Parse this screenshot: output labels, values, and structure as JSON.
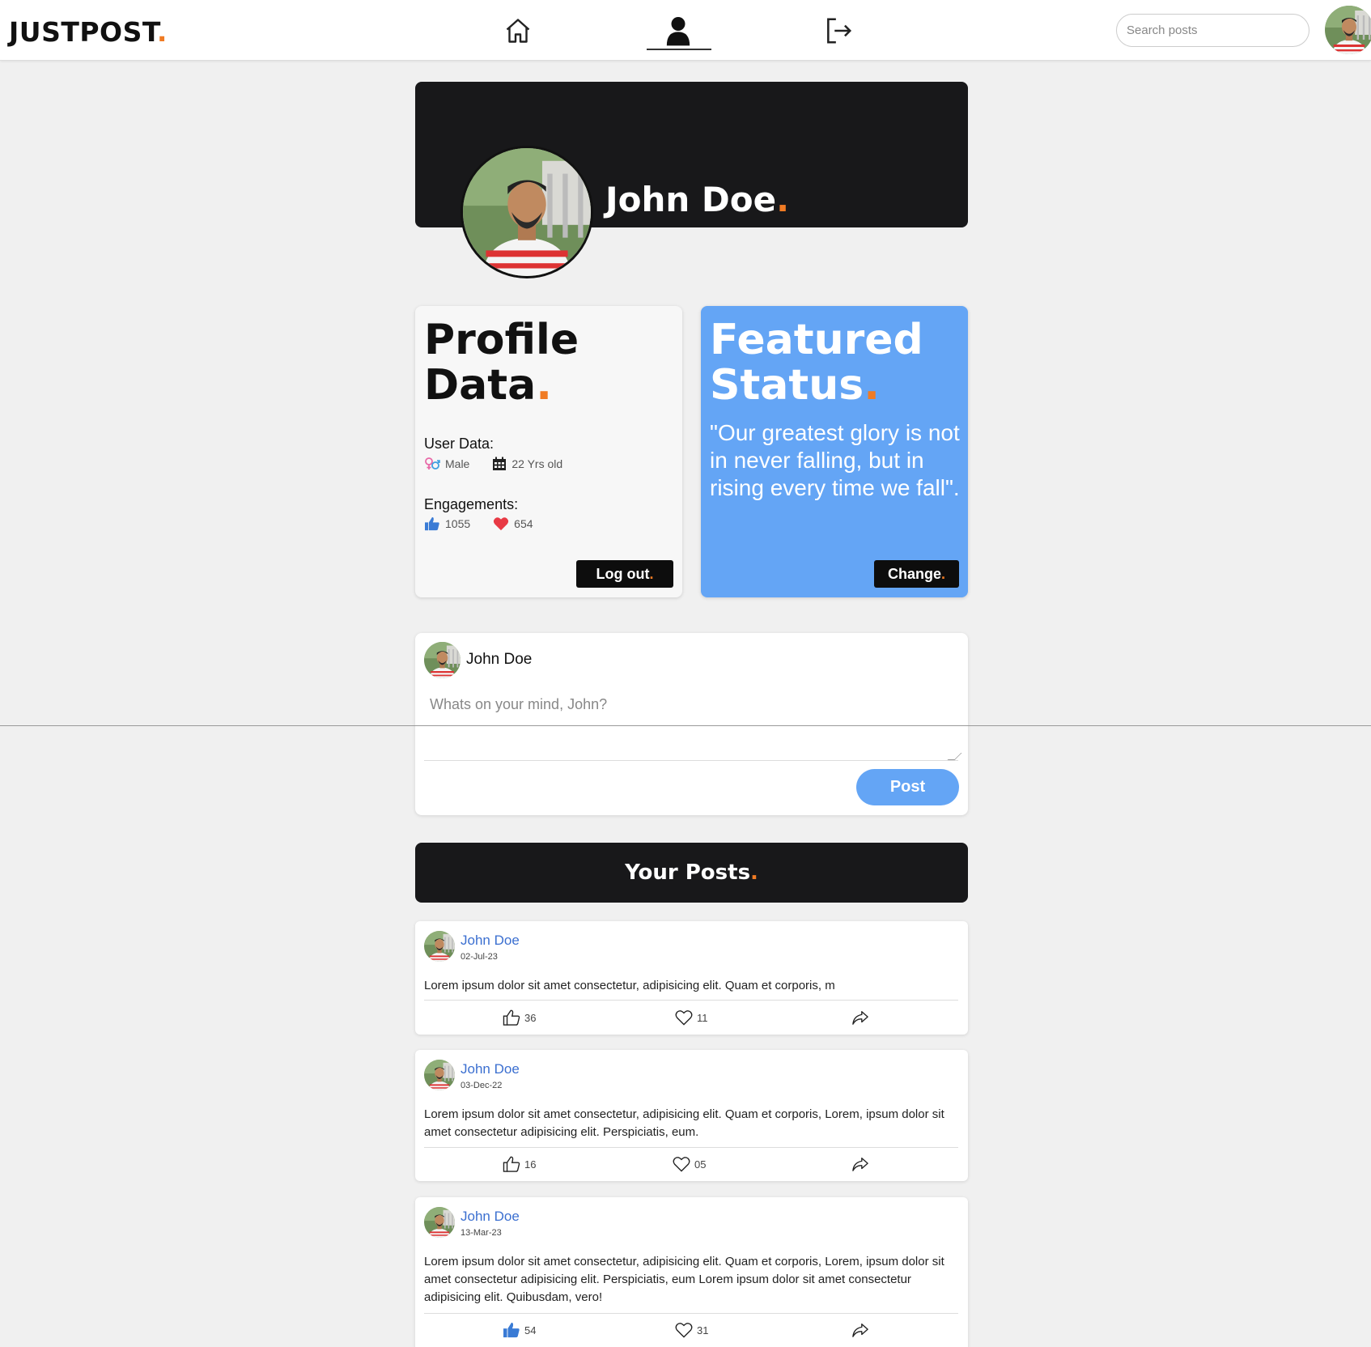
{
  "app": {
    "logo_text": "JUSTPOST",
    "logo_dot": ".",
    "accent": "#f07b24",
    "brand_blue": "#64a5f5"
  },
  "nav": {
    "items": [
      {
        "icon": "home-icon",
        "active": false
      },
      {
        "icon": "user-icon",
        "active": true
      },
      {
        "icon": "logout-icon",
        "active": false
      }
    ],
    "search_placeholder": "Search posts"
  },
  "profile": {
    "name": "John Doe",
    "dot": "."
  },
  "profile_data": {
    "title_line1": "Profile",
    "title_line2": "Data",
    "dot": ".",
    "user_data_label": "User Data:",
    "gender": "Male",
    "age": "22 Yrs old",
    "engagements_label": "Engagements:",
    "likes": "1055",
    "hearts": "654",
    "logout_label": "Log out",
    "logout_dot": "."
  },
  "featured": {
    "title_line1": "Featured",
    "title_line2": "Status",
    "dot": ".",
    "quote": "\"Our greatest glory is not in never falling, but in rising every time we fall\".",
    "change_label": "Change",
    "change_dot": "."
  },
  "composer": {
    "name": "John Doe",
    "placeholder": "Whats on your mind, John?",
    "post_label": "Post"
  },
  "posts_header": {
    "title": "Your Posts",
    "dot": "."
  },
  "posts": [
    {
      "author": "John Doe",
      "date": "02-Jul-23",
      "body": "Lorem ipsum dolor sit amet consectetur, adipisicing elit. Quam et corporis, m",
      "likes": "36",
      "hearts": "11",
      "liked": false
    },
    {
      "author": "John Doe",
      "date": "03-Dec-22",
      "body": "Lorem ipsum dolor sit amet consectetur, adipisicing elit. Quam et corporis, Lorem, ipsum dolor sit amet consectetur adipisicing elit. Perspiciatis, eum.",
      "likes": "16",
      "hearts": "05",
      "liked": false
    },
    {
      "author": "John Doe",
      "date": "13-Mar-23",
      "body": "Lorem ipsum dolor sit amet consectetur, adipisicing elit. Quam et corporis, Lorem, ipsum dolor sit amet consectetur adipisicing elit. Perspiciatis, eum Lorem ipsum dolor sit amet consectetur adipisicing elit. Quibusdam, vero!",
      "likes": "54",
      "hearts": "31",
      "liked": true
    }
  ]
}
